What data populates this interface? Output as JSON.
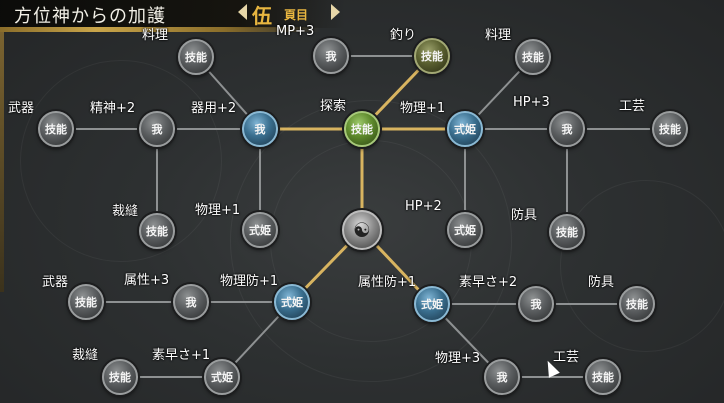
{
  "header": {
    "title": "方位神からの加護",
    "page_number": "伍",
    "page_suffix": "頁目",
    "prev_icon": "triangle-left",
    "next_icon": "triangle-right"
  },
  "labels": {
    "top_skill": "料理",
    "top_mp": "MP+3",
    "top_fishing": "釣り",
    "top_right_cooking": "料理",
    "left_weapon": "武器",
    "spirit": "精神+2",
    "dexterity": "器用+2",
    "explore": "探索",
    "physical_top": "物理+1",
    "hp3": "HP+3",
    "craft_right": "工芸",
    "sewing_left": "裁縫",
    "physical_left": "物理+1",
    "hp2": "HP+2",
    "armor_right": "防具",
    "weapon_lower": "武器",
    "attribute": "属性+3",
    "phys_def": "物理防+1",
    "attr_def": "属性防+1",
    "speed2": "素早さ+2",
    "armor_lower": "防具",
    "sewing_lower": "裁縫",
    "speed1": "素早さ+1",
    "physical_bottom": "物理+3",
    "craft_bottom": "工芸"
  },
  "node_text": {
    "skill": "技能",
    "self": "我",
    "shiki": "式姫",
    "center_symbol": "☯"
  },
  "colors": {
    "node_grey": "#5a5d5f",
    "node_blue": "#3a6f8f",
    "node_green": "#5e8a2c",
    "gold_line": "#c9a54a",
    "grey_line": "#8e9192"
  }
}
